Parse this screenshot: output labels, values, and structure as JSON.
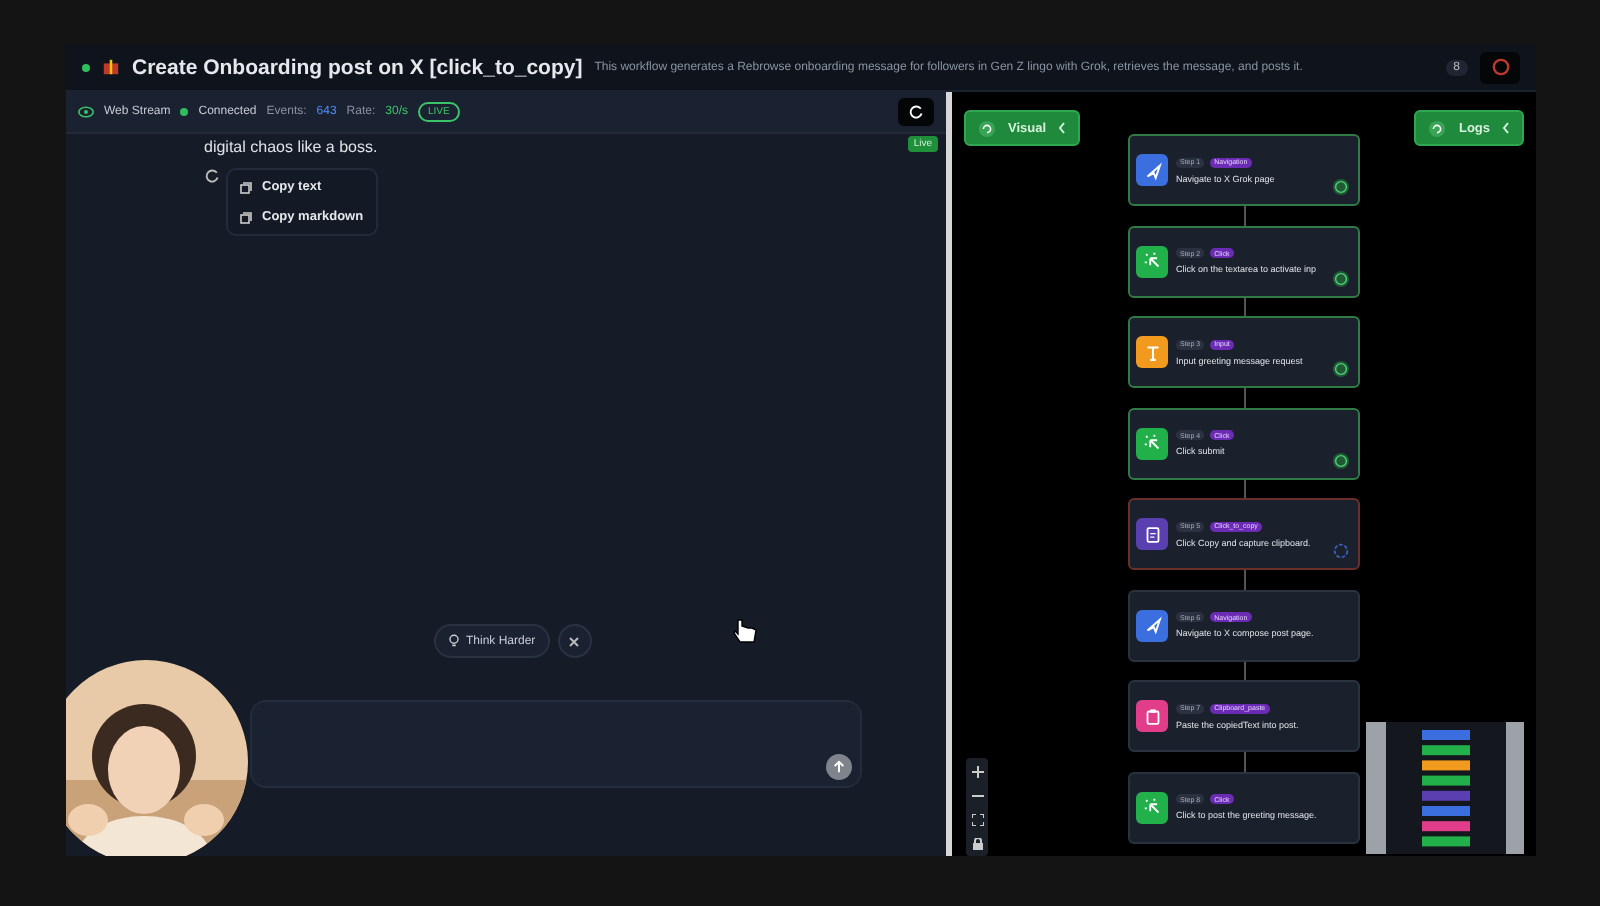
{
  "header": {
    "title": "Create Onboarding post on X [click_to_copy]",
    "description": "This workflow generates a Rebrowse onboarding message for followers in Gen Z lingo with Grok, retrieves the message, and posts it.",
    "count": "8"
  },
  "stream": {
    "label": "Web Stream",
    "status": "Connected",
    "events_label": "Events:",
    "events": "643",
    "rate_label": "Rate:",
    "rate": "30/s",
    "live": "LIVE",
    "live_tag": "Live"
  },
  "chat": {
    "message": "digital chaos like a boss.",
    "menu": [
      "Copy text",
      "Copy markdown"
    ],
    "think_button": "Think Harder"
  },
  "panels": {
    "visual": "Visual",
    "logs": "Logs"
  },
  "steps": [
    {
      "step": "Step 1",
      "tag": "Navigation",
      "text": "Navigate to X Grok page",
      "kind": "navigate",
      "color": "#3b6fe0",
      "completed": true,
      "running": false
    },
    {
      "step": "Step 2",
      "tag": "Click",
      "text": "Click on the textarea to activate inp",
      "kind": "click",
      "color": "#22b04b",
      "completed": true,
      "running": false
    },
    {
      "step": "Step 3",
      "tag": "Input",
      "text": "Input greeting message request",
      "kind": "input",
      "color": "#f29a1e",
      "completed": true,
      "running": false
    },
    {
      "step": "Step 4",
      "tag": "Click",
      "text": "Click submit",
      "kind": "click",
      "color": "#22b04b",
      "completed": true,
      "running": false
    },
    {
      "step": "Step 5",
      "tag": "Click_to_copy",
      "text": "Click Copy and capture clipboard.",
      "kind": "copy",
      "color": "#5a3fb0",
      "completed": false,
      "running": true
    },
    {
      "step": "Step 6",
      "tag": "Navigation",
      "text": "Navigate to X compose post page.",
      "kind": "navigate",
      "color": "#3b6fe0",
      "completed": false,
      "running": false
    },
    {
      "step": "Step 7",
      "tag": "Clipboard_paste",
      "text": "Paste the copiedText into post.",
      "kind": "paste",
      "color": "#e23d8a",
      "completed": false,
      "running": false
    },
    {
      "step": "Step 8",
      "tag": "Click",
      "text": "Click to post the greeting message.",
      "kind": "click",
      "color": "#22b04b",
      "completed": false,
      "running": false
    }
  ]
}
